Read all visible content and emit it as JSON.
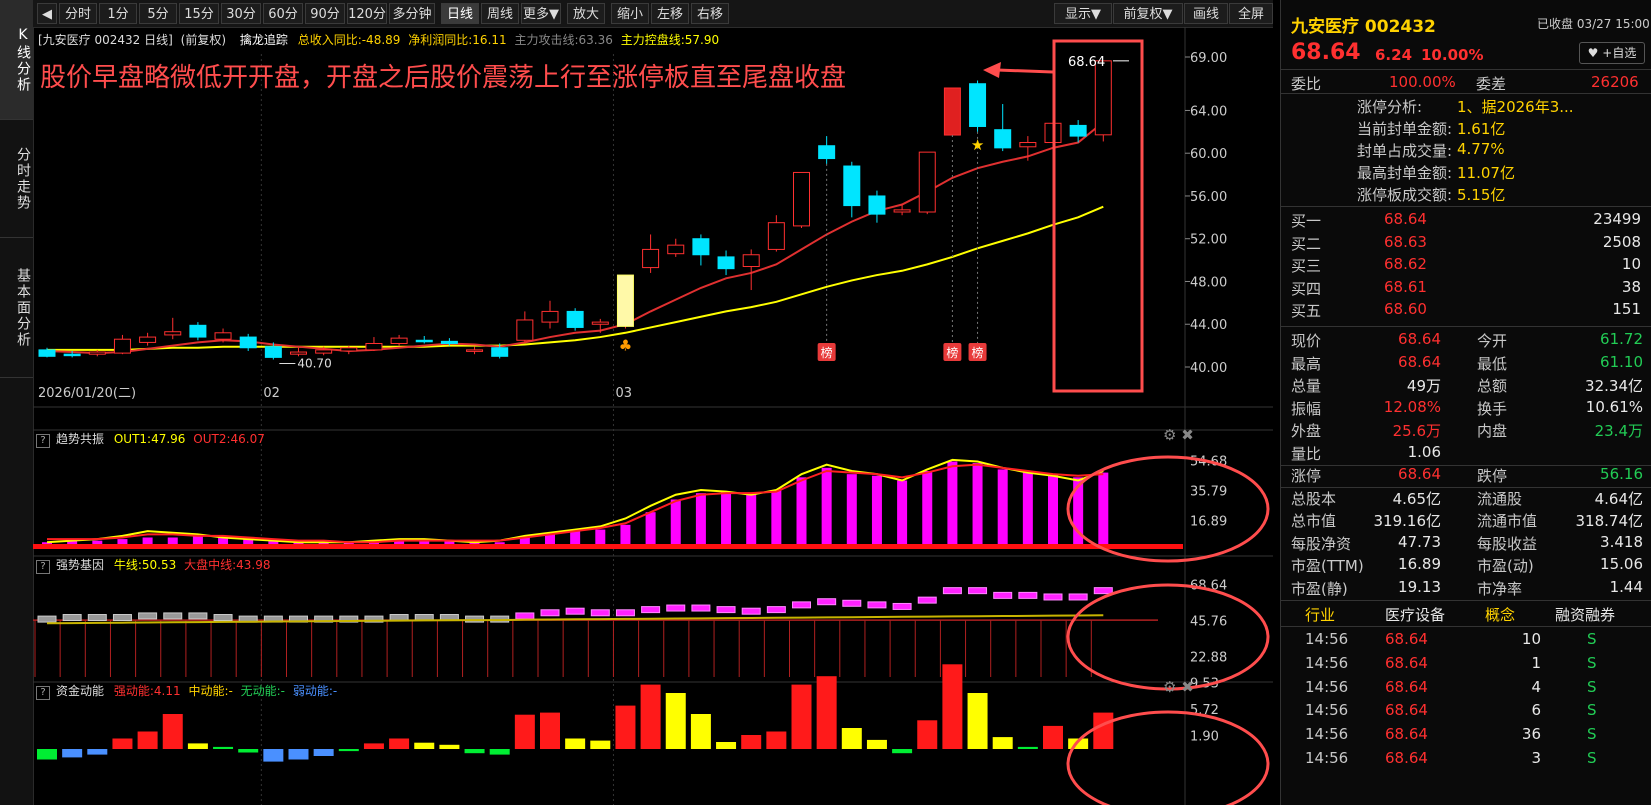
{
  "left_tabs": [
    "K线分析",
    "分时走势",
    "基本面分析"
  ],
  "toolbar": {
    "back_icon": "back-arrow-icon",
    "periods": [
      "分时",
      "1分",
      "5分",
      "15分",
      "30分",
      "60分",
      "90分",
      "120分",
      "多分钟",
      "日线",
      "周线",
      "更多▼",
      "放大",
      "缩小",
      "左移",
      "右移"
    ],
    "selected_period": "日线",
    "right_buttons": [
      "显示▼",
      "前复权▼",
      "画线",
      "全屏"
    ]
  },
  "info_line": {
    "stock": "[九安医疗 002432 日线]",
    "adj": "(前复权)",
    "indicator": "擒龙追踪",
    "revenue": "总收入同比:-48.89",
    "profit": "净利润同比:16.11",
    "attack": "主力攻击线:63.36",
    "control": "主力控盘线:57.90"
  },
  "annotation_text": "股价早盘略微低开开盘，开盘之后股价震荡上行至涨停板直至尾盘收盘",
  "price_axis": [
    "69.00",
    "64.00",
    "60.00",
    "56.00",
    "52.00",
    "48.00",
    "44.00",
    "40.00"
  ],
  "date_labels": [
    "2026/01/20(二)",
    "02",
    "03"
  ],
  "low_label": "40.70",
  "high_label": "68.64",
  "bang_label": "榜",
  "panel1": {
    "title": "趋势共振",
    "out1": "OUT1:47.96",
    "out2": "OUT2:46.07",
    "axis": [
      "54.68",
      "35.79",
      "16.89"
    ]
  },
  "panel2": {
    "title": "强势基因",
    "bull": "牛线:50.53",
    "market": "大盘中线:43.98",
    "axis": [
      "68.64",
      "45.76",
      "22.88"
    ]
  },
  "panel3": {
    "title": "资金动能",
    "strong": "强动能:4.11",
    "mid": "中动能:-",
    "none": "无动能:-",
    "weak": "弱动能:-",
    "axis": [
      "9.53",
      "5.72",
      "1.90"
    ]
  },
  "quote": {
    "name": "九安医疗 002432",
    "status": "已收盘 03/27 15:00",
    "price": "68.64",
    "change": "6.24",
    "pct": "10.00%",
    "watch_btn": "+自选",
    "wb_label": "委比",
    "wb": "100.00%",
    "wc_label": "委差",
    "wc": "26206",
    "limit_rows": [
      {
        "k": "涨停分析:",
        "v": "1、据2026年3..."
      },
      {
        "k": "当前封单金额:",
        "v": "1.61亿"
      },
      {
        "k": "封单占成交量:",
        "v": "4.77%"
      },
      {
        "k": "最高封单金额:",
        "v": "11.07亿"
      },
      {
        "k": "涨停板成交额:",
        "v": "5.15亿"
      }
    ],
    "bids": [
      {
        "k": "买一",
        "p": "68.64",
        "v": "23499"
      },
      {
        "k": "买二",
        "p": "68.63",
        "v": "2508"
      },
      {
        "k": "买三",
        "p": "68.62",
        "v": "10"
      },
      {
        "k": "买四",
        "p": "68.61",
        "v": "38"
      },
      {
        "k": "买五",
        "p": "68.60",
        "v": "151"
      }
    ],
    "stats": [
      {
        "k1": "现价",
        "v1": "68.64",
        "c1": "red",
        "k2": "今开",
        "v2": "61.72",
        "c2": "green"
      },
      {
        "k1": "最高",
        "v1": "68.64",
        "c1": "red",
        "k2": "最低",
        "v2": "61.10",
        "c2": "green"
      },
      {
        "k1": "总量",
        "v1": "49万",
        "c1": "white",
        "k2": "总额",
        "v2": "32.34亿",
        "c2": "white"
      },
      {
        "k1": "振幅",
        "v1": "12.08%",
        "c1": "red",
        "k2": "换手",
        "v2": "10.61%",
        "c2": "white"
      },
      {
        "k1": "外盘",
        "v1": "25.6万",
        "c1": "red",
        "k2": "内盘",
        "v2": "23.4万",
        "c2": "green"
      },
      {
        "k1": "量比",
        "v1": "1.06",
        "c1": "white",
        "k2": "",
        "v2": "",
        "c2": "white"
      },
      {
        "k1": "涨停",
        "v1": "68.64",
        "c1": "red",
        "k2": "跌停",
        "v2": "56.16",
        "c2": "green"
      },
      {
        "k1": "总股本",
        "v1": "4.65亿",
        "c1": "white",
        "k2": "流通股",
        "v2": "4.64亿",
        "c2": "white"
      },
      {
        "k1": "总市值",
        "v1": "319.16亿",
        "c1": "white",
        "k2": "流通市值",
        "v2": "318.74亿",
        "c2": "white"
      },
      {
        "k1": "每股净资",
        "v1": "47.73",
        "c1": "white",
        "k2": "每股收益",
        "v2": "3.418",
        "c2": "white"
      },
      {
        "k1": "市盈(TTM)",
        "v1": "16.89",
        "c1": "white",
        "k2": "市盈(动)",
        "v2": "15.06",
        "c2": "white"
      },
      {
        "k1": "市盈(静)",
        "v1": "19.13",
        "c1": "white",
        "k2": "市净率",
        "v2": "1.44",
        "c2": "white"
      }
    ],
    "tabs": [
      "行业",
      "医疗设备",
      "概念",
      "融资融券"
    ],
    "ticks": [
      {
        "t": "14:56",
        "p": "68.64",
        "v": "10",
        "s": "S"
      },
      {
        "t": "14:56",
        "p": "68.64",
        "v": "1",
        "s": "S"
      },
      {
        "t": "14:56",
        "p": "68.64",
        "v": "4",
        "s": "S"
      },
      {
        "t": "14:56",
        "p": "68.64",
        "v": "6",
        "s": "S"
      },
      {
        "t": "14:56",
        "p": "68.64",
        "v": "36",
        "s": "S"
      },
      {
        "t": "14:56",
        "p": "68.64",
        "v": "3",
        "s": "S"
      }
    ]
  },
  "colors": {
    "up": "#ff3030",
    "down": "#00e5ff",
    "ma_yellow": "#ffff00",
    "ma_red": "#e03030",
    "magenta": "#ff00ff",
    "annotation": "#ff4d4d"
  },
  "chart_data": {
    "type": "candlestick",
    "ylim": [
      40,
      69
    ],
    "candles": [
      {
        "o": 41.6,
        "c": 41.0,
        "h": 41.8,
        "l": 40.9
      },
      {
        "o": 41.2,
        "c": 41.1,
        "h": 41.5,
        "l": 40.9
      },
      {
        "o": 41.2,
        "c": 41.4,
        "h": 41.6,
        "l": 41.0
      },
      {
        "o": 41.3,
        "c": 42.6,
        "h": 43.0,
        "l": 41.2
      },
      {
        "o": 42.3,
        "c": 42.8,
        "h": 43.2,
        "l": 42.0
      },
      {
        "o": 43.0,
        "c": 43.3,
        "h": 44.6,
        "l": 42.6
      },
      {
        "o": 43.9,
        "c": 42.8,
        "h": 44.2,
        "l": 42.5
      },
      {
        "o": 42.6,
        "c": 43.2,
        "h": 43.6,
        "l": 42.3
      },
      {
        "o": 42.8,
        "c": 41.8,
        "h": 43.1,
        "l": 41.5
      },
      {
        "o": 41.9,
        "c": 40.9,
        "h": 42.3,
        "l": 40.7
      },
      {
        "o": 41.2,
        "c": 41.4,
        "h": 41.8,
        "l": 41.0
      },
      {
        "o": 41.3,
        "c": 41.6,
        "h": 41.9,
        "l": 41.1
      },
      {
        "o": 41.5,
        "c": 41.8,
        "h": 42.0,
        "l": 41.2
      },
      {
        "o": 41.6,
        "c": 42.2,
        "h": 42.8,
        "l": 41.5
      },
      {
        "o": 42.2,
        "c": 42.7,
        "h": 43.0,
        "l": 42.0
      },
      {
        "o": 42.5,
        "c": 42.4,
        "h": 42.9,
        "l": 42.2
      },
      {
        "o": 42.4,
        "c": 42.2,
        "h": 42.7,
        "l": 42.0
      },
      {
        "o": 41.5,
        "c": 41.6,
        "h": 41.9,
        "l": 41.2
      },
      {
        "o": 41.8,
        "c": 41.0,
        "h": 42.2,
        "l": 40.8
      },
      {
        "o": 42.5,
        "c": 44.4,
        "h": 45.2,
        "l": 42.3
      },
      {
        "o": 44.2,
        "c": 45.2,
        "h": 46.2,
        "l": 43.6
      },
      {
        "o": 45.2,
        "c": 43.7,
        "h": 45.5,
        "l": 43.4
      },
      {
        "o": 44.0,
        "c": 44.2,
        "h": 44.5,
        "l": 43.2
      },
      {
        "o": 43.8,
        "c": 48.6,
        "h": 48.6,
        "l": 43.6
      },
      {
        "o": 49.3,
        "c": 51.0,
        "h": 52.4,
        "l": 48.8
      },
      {
        "o": 50.6,
        "c": 51.4,
        "h": 52.0,
        "l": 50.3
      },
      {
        "o": 52.0,
        "c": 50.5,
        "h": 52.4,
        "l": 49.5
      },
      {
        "o": 50.3,
        "c": 49.2,
        "h": 50.9,
        "l": 48.6
      },
      {
        "o": 49.4,
        "c": 50.5,
        "h": 51.0,
        "l": 47.2
      },
      {
        "o": 51.0,
        "c": 53.5,
        "h": 54.2,
        "l": 50.8
      },
      {
        "o": 53.2,
        "c": 58.2,
        "h": 58.2,
        "l": 53.0
      },
      {
        "o": 60.7,
        "c": 59.5,
        "h": 61.6,
        "l": 59.0
      },
      {
        "o": 58.8,
        "c": 55.1,
        "h": 59.2,
        "l": 54.0
      },
      {
        "o": 56.0,
        "c": 54.3,
        "h": 56.5,
        "l": 53.5
      },
      {
        "o": 54.5,
        "c": 54.7,
        "h": 55.2,
        "l": 54.2
      },
      {
        "o": 54.5,
        "c": 60.1,
        "h": 60.1,
        "l": 54.3
      },
      {
        "o": 61.7,
        "c": 66.1,
        "h": 66.1,
        "l": 61.7
      },
      {
        "o": 66.5,
        "c": 62.5,
        "h": 66.8,
        "l": 62.0
      },
      {
        "o": 62.2,
        "c": 60.5,
        "h": 64.6,
        "l": 60.2
      },
      {
        "o": 60.6,
        "c": 61.0,
        "h": 61.6,
        "l": 59.3
      },
      {
        "o": 61.0,
        "c": 62.8,
        "h": 65.8,
        "l": 60.6
      },
      {
        "o": 62.6,
        "c": 61.6,
        "h": 63.1,
        "l": 61.0
      },
      {
        "o": 61.72,
        "c": 68.64,
        "h": 68.64,
        "l": 61.1
      }
    ],
    "ma_red": [
      41.5,
      41.4,
      41.3,
      41.4,
      41.7,
      42.0,
      42.3,
      42.5,
      42.4,
      42.1,
      41.9,
      41.7,
      41.5,
      41.6,
      41.8,
      42.0,
      42.2,
      42.1,
      41.9,
      42.3,
      42.8,
      43.2,
      43.4,
      44.0,
      45.2,
      46.3,
      47.4,
      48.3,
      48.8,
      49.6,
      51.0,
      52.4,
      53.6,
      54.6,
      55.2,
      56.4,
      57.7,
      58.6,
      59.2,
      59.7,
      60.5,
      61.0,
      62.9
    ],
    "ma_yellow": [
      41.6,
      41.6,
      41.6,
      41.6,
      41.7,
      41.8,
      41.8,
      41.9,
      41.9,
      41.9,
      41.9,
      41.9,
      41.9,
      41.9,
      41.9,
      41.9,
      42.0,
      42.0,
      42.0,
      42.1,
      42.3,
      42.5,
      42.8,
      43.2,
      43.7,
      44.2,
      44.7,
      45.2,
      45.6,
      46.1,
      46.8,
      47.5,
      48.1,
      48.6,
      49.0,
      49.6,
      50.3,
      51.1,
      51.8,
      52.5,
      53.3,
      54.0,
      55.0
    ],
    "panel1_bars": [
      3,
      4,
      4,
      5,
      6,
      6,
      7,
      6,
      5,
      4,
      3,
      3,
      3,
      3,
      4,
      5,
      4,
      3,
      3,
      6,
      8,
      10,
      11,
      14,
      22,
      30,
      34,
      35,
      34,
      36,
      44,
      50,
      46,
      45,
      42,
      48,
      54,
      53,
      49,
      47,
      46,
      44,
      47
    ],
    "panel1_out1": [
      3,
      4,
      5,
      7,
      10,
      9,
      8,
      6,
      5,
      4,
      3,
      3,
      3,
      4,
      5,
      5,
      4,
      3,
      4,
      7,
      9,
      11,
      13,
      18,
      26,
      33,
      36,
      35,
      33,
      36,
      46,
      52,
      48,
      46,
      42,
      49,
      55,
      54,
      50,
      47,
      45,
      42,
      48
    ],
    "panel1_out2": [
      5,
      5,
      5,
      6,
      8,
      8,
      7,
      7,
      6,
      5,
      4,
      4,
      3,
      3,
      4,
      4,
      4,
      4,
      4,
      6,
      8,
      10,
      12,
      15,
      22,
      29,
      33,
      34,
      34,
      35,
      42,
      48,
      47,
      46,
      44,
      47,
      51,
      52,
      50,
      48,
      46,
      45,
      46
    ],
    "panel2_bull": [
      46,
      47,
      47,
      47,
      48,
      48,
      48,
      47,
      46,
      46,
      46,
      46,
      46,
      46,
      47,
      47,
      47,
      46,
      46,
      48,
      50,
      51,
      50,
      50,
      52,
      53,
      53,
      52,
      51,
      52,
      55,
      57,
      56,
      55,
      54,
      58,
      64,
      64,
      61,
      61,
      60,
      60,
      64
    ],
    "panel2_gray": [
      true,
      true,
      true,
      true,
      true,
      true,
      true,
      true,
      true,
      true,
      true,
      true,
      true,
      true,
      true,
      true,
      true,
      true,
      true,
      false,
      false,
      false,
      false,
      false,
      false,
      false,
      false,
      false,
      false,
      false,
      false,
      false,
      false,
      false,
      false,
      false,
      false,
      false,
      false,
      false,
      false,
      false,
      false
    ],
    "panel3_bars": [
      -1.5,
      -1.2,
      -0.8,
      1.5,
      2.5,
      5.0,
      0.8,
      0.3,
      -0.5,
      -1.8,
      -1.5,
      -1.0,
      -0.3,
      0.8,
      1.5,
      0.9,
      0.6,
      -0.6,
      -0.8,
      4.9,
      5.2,
      1.5,
      1.2,
      6.2,
      9.2,
      8.0,
      5.0,
      1.0,
      2.0,
      2.5,
      9.2,
      10.4,
      3.0,
      1.3,
      -0.6,
      4.1,
      12.1,
      8.0,
      1.7,
      0.3,
      3.3,
      1.5,
      5.2
    ],
    "panel3_colors": [
      "green",
      "blue",
      "blue",
      "red",
      "red",
      "red",
      "yellow",
      "green",
      "green",
      "blue",
      "blue",
      "blue",
      "green",
      "red",
      "red",
      "yellow",
      "yellow",
      "green",
      "green",
      "red",
      "red",
      "yellow",
      "yellow",
      "red",
      "red",
      "yellow",
      "yellow",
      "yellow",
      "red",
      "red",
      "red",
      "red",
      "yellow",
      "yellow",
      "green",
      "red",
      "red",
      "yellow",
      "yellow",
      "green",
      "red",
      "yellow",
      "red"
    ]
  }
}
